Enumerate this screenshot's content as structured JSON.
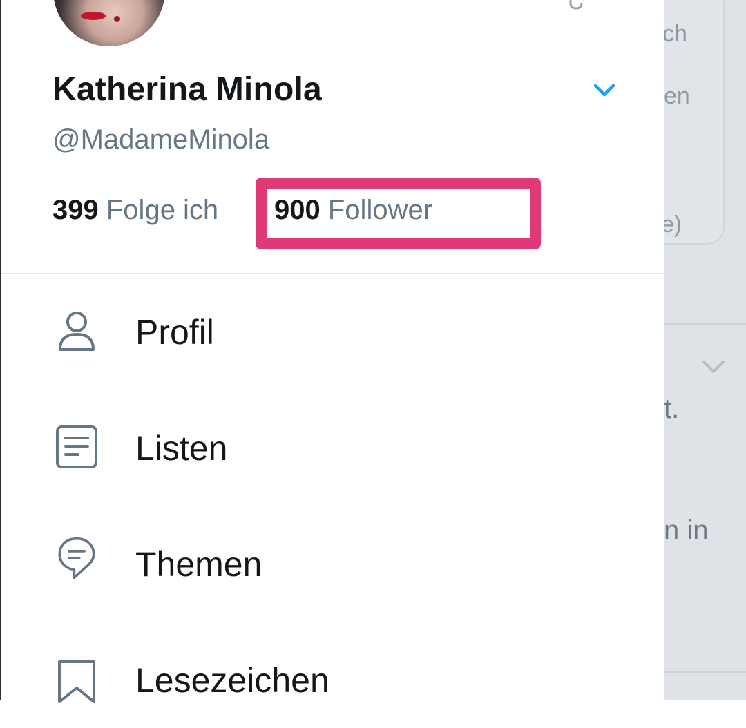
{
  "profile": {
    "name": "Katherina Minola",
    "handle": "@MadameMinola",
    "following_count": "399",
    "following_label": "Folge ich",
    "followers_count": "900",
    "followers_label": "Follower"
  },
  "menu": {
    "items": [
      {
        "label": "Profil",
        "icon": "person-icon"
      },
      {
        "label": "Listen",
        "icon": "list-icon"
      },
      {
        "label": "Themen",
        "icon": "topics-icon"
      },
      {
        "label": "Lesezeichen",
        "icon": "bookmark-icon"
      }
    ]
  },
  "background": {
    "fragments": [
      "ch",
      "en",
      "e)",
      "t.",
      "n in"
    ]
  },
  "colors": {
    "accent": "#1da1f2",
    "highlight": "#e0397a",
    "secondary_text": "#657786",
    "primary_text": "#14171a"
  }
}
